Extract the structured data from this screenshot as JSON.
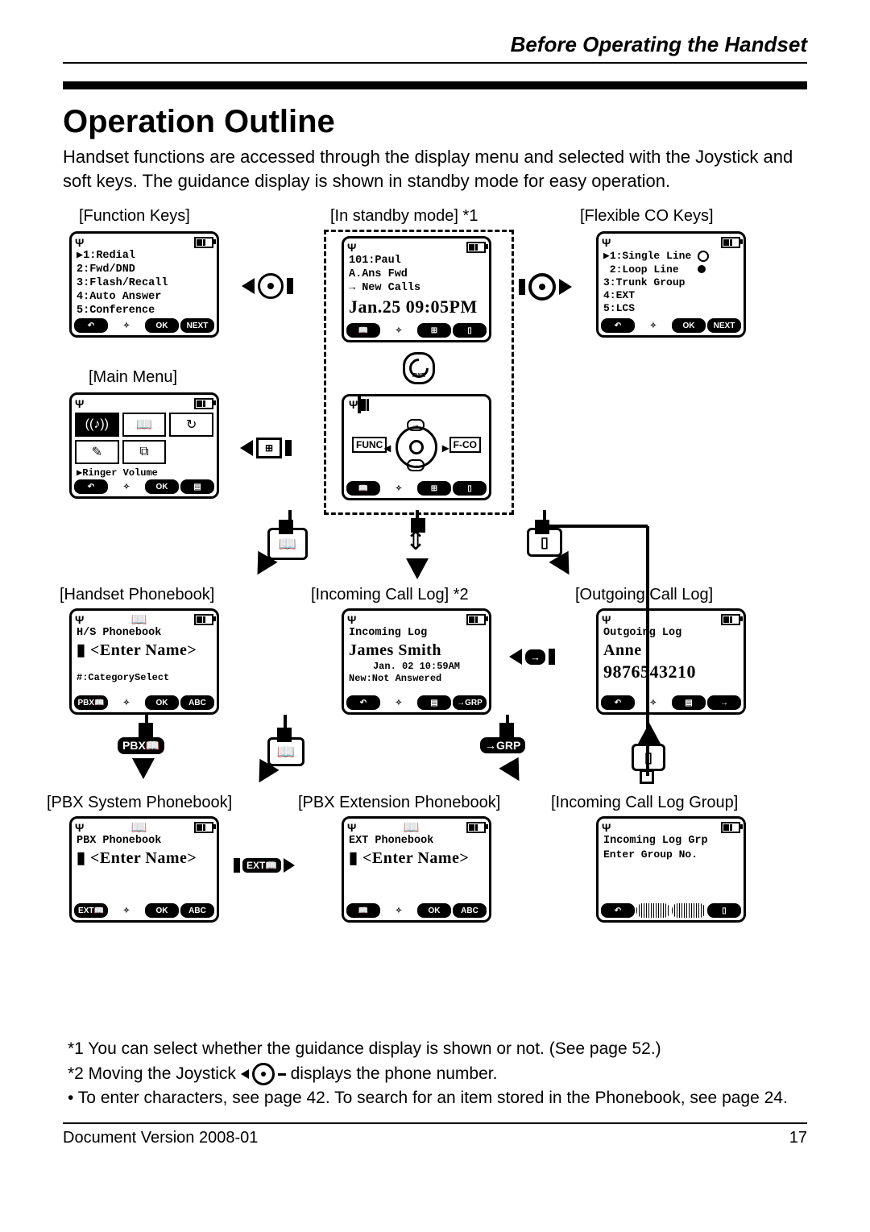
{
  "header": {
    "section": "Before Operating the Handset"
  },
  "title": "Operation Outline",
  "intro": "Handset functions are accessed through the display menu and selected with the Joystick and soft keys. The guidance display is shown in standby mode for easy operation.",
  "captions": {
    "function_keys": "[Function Keys]",
    "standby": "[In standby mode] *1",
    "flexible": "[Flexible CO Keys]",
    "main_menu": "[Main Menu]",
    "hs_phonebook": "[Handset Phonebook]",
    "incoming_log": "[Incoming Call Log] *2",
    "outgoing_log": "[Outgoing Call Log]",
    "pbx_sys": "[PBX System Phonebook]",
    "pbx_ext": "[PBX Extension Phonebook]",
    "inc_grp": "[Incoming Call Log Group]"
  },
  "screens": {
    "function_keys": {
      "lines": [
        "▶1:Redial",
        " 2:Fwd/DND",
        " 3:Flash/Recall",
        " 4:Auto Answer",
        " 5:Conference"
      ],
      "soft": [
        "↶",
        "✧",
        "OK",
        "NEXT"
      ]
    },
    "standby": {
      "lines": [
        "101:Paul",
        "  A.Ans Fwd",
        " → New Calls"
      ],
      "big": "Jan.25 09:05PM",
      "soft": [
        "📖",
        "✧",
        "⊞",
        "▯"
      ]
    },
    "flexible": {
      "lines": [
        "▶1:Single Line ○",
        " 2:Loop Line   ●",
        " 3:Trunk Group",
        " 4:EXT",
        " 5:LCS"
      ],
      "soft": [
        "↶",
        "✧",
        "OK",
        "NEXT"
      ]
    },
    "main_menu": {
      "icons": [
        "((♪))",
        "📖",
        "↻",
        "✎",
        "⧉",
        ""
      ],
      "label": "▶Ringer Volume",
      "soft": [
        "↶",
        "✧",
        "OK",
        "▤"
      ]
    },
    "joy": {
      "func": "FUNC",
      "fco": "F-CO",
      "soft": [
        "📖",
        "✧",
        "⊞",
        "▯"
      ]
    },
    "hs_phonebook": {
      "title": "H/S Phonebook",
      "big": "▮ <Enter Name>",
      "sub": "#:CategorySelect",
      "soft": [
        "PBX📖",
        "✧",
        "OK",
        "ABC"
      ]
    },
    "incoming_log": {
      "title": "Incoming Log",
      "big": "James Smith",
      "sub1": "Jan. 02 10:59AM",
      "sub2": "New:Not Answered",
      "soft": [
        "↶",
        "✧",
        "▤",
        "→GRP"
      ]
    },
    "outgoing_log": {
      "title": "Outgoing Log",
      "big": "Anne",
      "big2": "9876543210",
      "soft": [
        "↶",
        "✧",
        "▤",
        "→"
      ]
    },
    "pbx_sys": {
      "title": "PBX Phonebook",
      "big": "▮ <Enter Name>",
      "soft": [
        "EXT📖",
        "✧",
        "OK",
        "ABC"
      ]
    },
    "pbx_ext": {
      "title": "EXT Phonebook",
      "big": "▮ <Enter Name>",
      "soft": [
        "📖",
        "✧",
        "OK",
        "ABC"
      ]
    },
    "inc_grp": {
      "title": "Incoming Log Grp",
      "sub": "Enter Group No.",
      "soft": [
        "↶",
        "",
        "▤",
        "▯"
      ]
    }
  },
  "chips": {
    "pbx": "PBX📖",
    "grp": "→GRP",
    "ext": "▮EXT📖▮"
  },
  "notes": {
    "n1": "*1   You can select whether the guidance display is shown or not. (See page 52.)",
    "n2a": "*2   Moving the Joystick ",
    "n2b": " displays the phone number.",
    "n3": "•    To enter characters, see page 42. To search for an item stored in the Phonebook, see page 24."
  },
  "footer": {
    "left": "Document Version 2008-01",
    "right": "17"
  }
}
